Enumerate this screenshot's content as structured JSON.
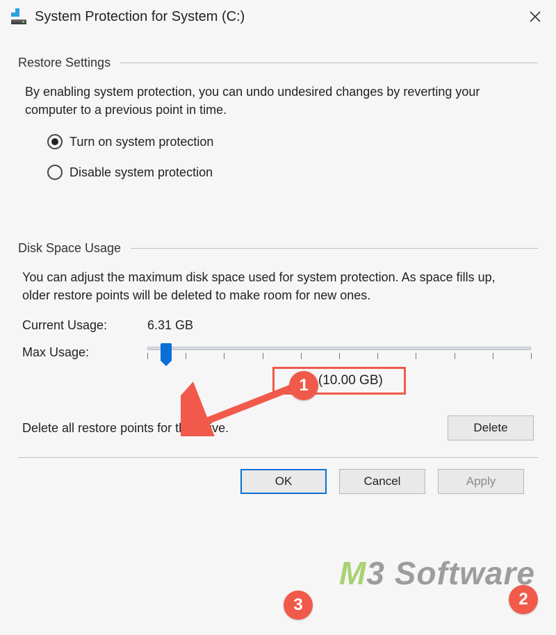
{
  "window": {
    "title": "System Protection for System (C:)"
  },
  "restore": {
    "section_label": "Restore Settings",
    "description": "By enabling system protection, you can undo undesired changes by reverting your computer to a previous point in time.",
    "option_on": "Turn on system protection",
    "option_off": "Disable system protection",
    "selected": "on"
  },
  "disk": {
    "section_label": "Disk Space Usage",
    "description": "You can adjust the maximum disk space used for system protection. As space fills up, older restore points will be deleted to make room for new ones.",
    "current_label": "Current Usage:",
    "current_value": "6.31 GB",
    "max_label": "Max Usage:",
    "slider_percent": 5,
    "slider_display": "5% (10.00 GB)",
    "delete_text": "Delete all restore points for this drive.",
    "delete_button": "Delete"
  },
  "buttons": {
    "ok": "OK",
    "cancel": "Cancel",
    "apply": "Apply"
  },
  "annotations": {
    "badge1": "1",
    "badge2": "2",
    "badge3": "3"
  },
  "watermark": {
    "m": "M",
    "three": "3",
    "rest": " Software"
  }
}
